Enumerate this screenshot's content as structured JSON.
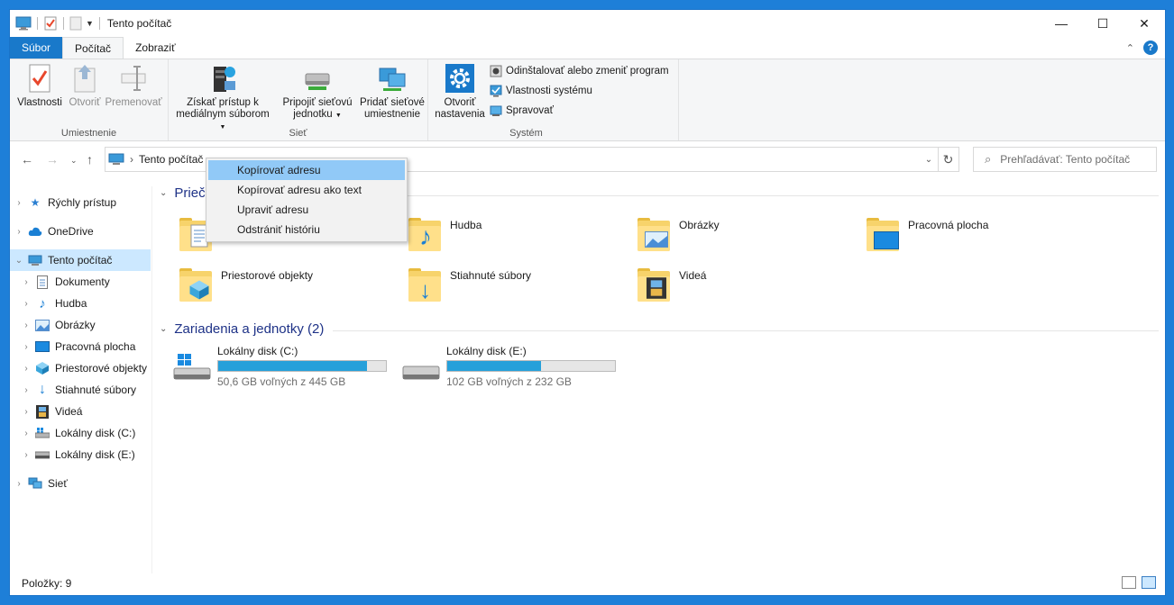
{
  "window": {
    "title": "Tento počítač"
  },
  "ribbon_tabs": [
    "Súbor",
    "Počítač",
    "Zobraziť"
  ],
  "ribbon": {
    "groups": {
      "location": {
        "label": "Umiestnenie",
        "buttons": [
          "Vlastnosti",
          "Otvoriť",
          "Premenovať"
        ]
      },
      "network": {
        "label": "Sieť",
        "media_line1": "Získať prístup k",
        "media_line2": "mediálnym súborom",
        "map_line1": "Pripojiť sieťovú",
        "map_line2": "jednotku",
        "add_line1": "Pridať sieťové",
        "add_line2": "umiestnenie"
      },
      "system": {
        "label": "Systém",
        "open_line1": "Otvoriť",
        "open_line2": "nastavenia",
        "uninstall": "Odinštalovať alebo zmeniť program",
        "sysprops": "Vlastnosti systému",
        "manage": "Spravovať"
      }
    }
  },
  "address": {
    "path": "Tento počítač"
  },
  "search": {
    "placeholder": "Prehľadávať: Tento počítač"
  },
  "sidebar": {
    "items": [
      "Rýchly prístup",
      "OneDrive",
      "Tento počítač",
      "Dokumenty",
      "Hudba",
      "Obrázky",
      "Pracovná plocha",
      "Priestorové objekty",
      "Stiahnuté súbory",
      "Videá",
      "Lokálny disk (C:)",
      "Lokálny disk (E:)",
      "Sieť"
    ]
  },
  "content": {
    "folders_heading": "Prieči",
    "folders": [
      "Hudba",
      "Obrázky",
      "Pracovná plocha",
      "Priestorové objekty",
      "Stiahnuté súbory",
      "Videá"
    ],
    "drives_heading": "Zariadenia a jednotky (2)",
    "drives": [
      {
        "name": "Lokálny disk (C:)",
        "free": "50,6 GB voľných z 445 GB",
        "used_fraction": 0.886
      },
      {
        "name": "Lokálny disk (E:)",
        "free": "102 GB voľných z 232 GB",
        "used_fraction": 0.56
      }
    ]
  },
  "context_menu": [
    "Kopírovať adresu",
    "Kopírovať adresu ako text",
    "Upraviť adresu",
    "Odstrániť históriu"
  ],
  "status": {
    "items": "Položky: 9"
  },
  "colors": {
    "accent": "#1979ca",
    "selected": "#cce8ff",
    "menu_highlight": "#91c9f7",
    "drive_bar": "#26a0da"
  }
}
